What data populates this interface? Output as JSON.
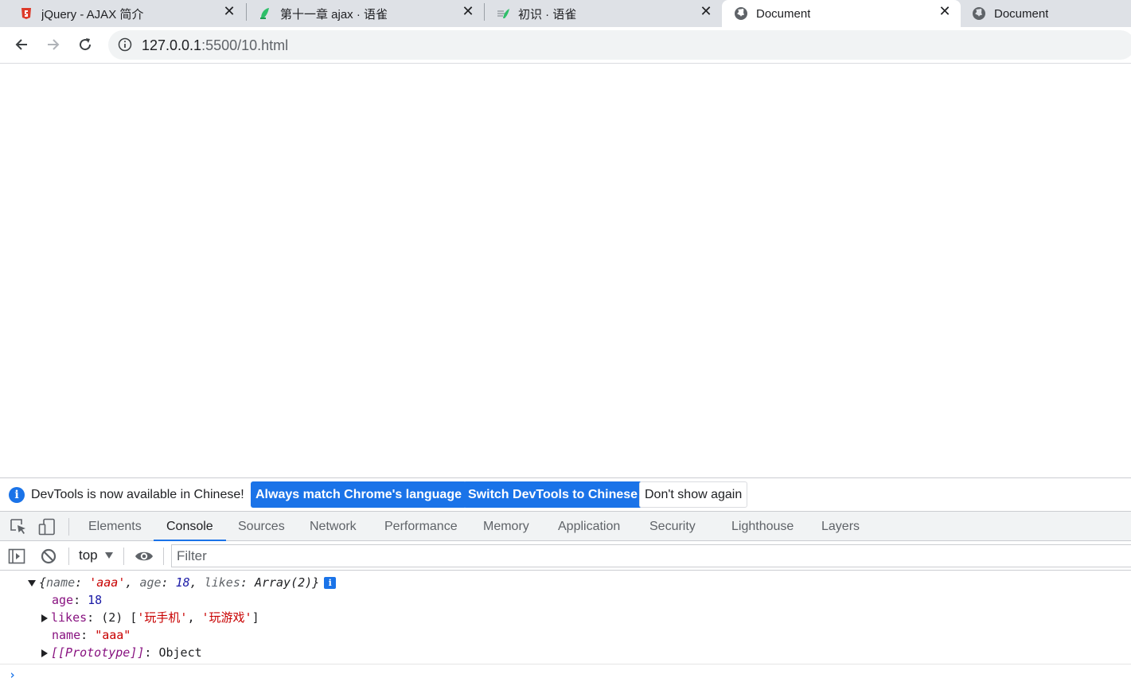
{
  "browser": {
    "tabs": [
      {
        "title": "jQuery - AJAX 简介",
        "icon": "jquery-icon",
        "active": false
      },
      {
        "title": "第十一章 ajax · 语雀",
        "icon": "yuque-icon",
        "active": false
      },
      {
        "title": "初识 · 语雀",
        "icon": "yuque-icon",
        "active": false
      },
      {
        "title": "Document",
        "icon": "globe-icon",
        "active": true
      },
      {
        "title": "Document",
        "icon": "globe-icon",
        "active": false
      }
    ],
    "close_glyph": "✕",
    "address": {
      "host": "127.0.0.1",
      "rest": ":5500/10.html"
    }
  },
  "devtools": {
    "infobar": {
      "message": "DevTools is now available in Chinese!",
      "btn_match": "Always match Chrome's language",
      "btn_switch": "Switch DevTools to Chinese",
      "btn_dismiss": "Don't show again"
    },
    "tabs": [
      "Elements",
      "Console",
      "Sources",
      "Network",
      "Performance",
      "Memory",
      "Application",
      "Security",
      "Lighthouse",
      "Layers"
    ],
    "active_tab": "Console",
    "console_bar": {
      "context": "top",
      "filter_placeholder": "Filter"
    },
    "console": {
      "summary_open": "{",
      "summary_name_key": "name",
      "summary_name_val": "'aaa'",
      "summary_age_key": "age",
      "summary_age_val": "18",
      "summary_likes_key": "likes",
      "summary_likes_val": "Array(2)",
      "summary_close": "}",
      "badge": "i",
      "age_key": "age",
      "age_val": "18",
      "likes_key": "likes",
      "likes_count": "(2)",
      "likes_item1": "'玩手机'",
      "likes_item2": "'玩游戏'",
      "name_key": "name",
      "name_val": "\"aaa\"",
      "proto_key": "[[Prototype]]",
      "proto_val": "Object",
      "prompt": "›"
    },
    "colors": {
      "accent": "#1a73e8",
      "string": "#c80000",
      "number": "#1a1aa6",
      "key": "#881280"
    }
  }
}
